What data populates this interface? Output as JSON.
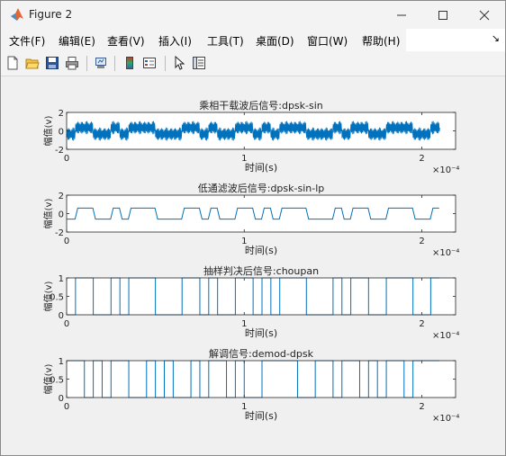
{
  "window": {
    "title": "Figure 2"
  },
  "menu": [
    "文件(F)",
    "编辑(E)",
    "查看(V)",
    "插入(I)",
    "工具(T)",
    "桌面(D)",
    "窗口(W)",
    "帮助(H)"
  ],
  "menu_overflow": "↘",
  "toolbar_icons": [
    "new-figure-icon",
    "open-file-icon",
    "save-icon",
    "print-icon",
    "link-plot-icon",
    "insert-colorbar-icon",
    "insert-legend-icon",
    "edit-plot-arrow-icon",
    "property-inspector-icon"
  ],
  "colors": {
    "line": "#0072bd",
    "axes_bg": "#ffffff",
    "figure_bg": "#f0f0f0"
  },
  "chart_data": [
    {
      "type": "line",
      "title": "乘相干载波后信号:dpsk-sin",
      "xlabel": "时间(s)",
      "ylabel": "幅值(v)",
      "xlim": [
        0,
        0.000219
      ],
      "ylim": [
        -2,
        2
      ],
      "xticks": [
        "0",
        "1",
        "2"
      ],
      "yticks": [
        "2",
        "0",
        "-2"
      ],
      "x_exponent": "×10⁻⁴",
      "bits_per_panel": 42,
      "bit_duration_s": 5e-06,
      "bits": [
        0,
        1,
        1,
        0,
        0,
        1,
        0,
        1,
        1,
        1,
        0,
        0,
        0,
        1,
        1,
        0,
        1,
        0,
        0,
        1,
        1,
        0,
        1,
        0,
        1,
        1,
        1,
        0,
        0,
        0,
        1,
        0,
        1,
        1,
        0,
        0,
        1,
        1,
        1,
        0,
        0,
        1
      ],
      "note": "modulated carrier, amplitude ~±1.2"
    },
    {
      "type": "line",
      "title": "低通滤波后信号:dpsk-sin-lp",
      "xlabel": "时间(s)",
      "ylabel": "幅值(v)",
      "xlim": [
        0,
        0.000219
      ],
      "ylim": [
        -2,
        2
      ],
      "xticks": [
        "0",
        "1",
        "2"
      ],
      "yticks": [
        "2",
        "0",
        "-2"
      ],
      "x_exponent": "×10⁻⁴",
      "bits": [
        0,
        1,
        1,
        0,
        0,
        1,
        0,
        1,
        1,
        1,
        0,
        0,
        0,
        1,
        1,
        0,
        1,
        0,
        0,
        1,
        1,
        0,
        1,
        0,
        1,
        1,
        1,
        0,
        0,
        0,
        1,
        0,
        1,
        1,
        0,
        0,
        1,
        1,
        1,
        0,
        0,
        1
      ],
      "high": 0.6,
      "low": -0.6
    },
    {
      "type": "line",
      "title": "抽样判决后信号:choupan",
      "xlabel": "时间(s)",
      "ylabel": "幅值(v)",
      "xlim": [
        0,
        0.000219
      ],
      "ylim": [
        0,
        1
      ],
      "xticks": [
        "0",
        "1",
        "2"
      ],
      "yticks": [
        "1",
        "0.5",
        "0"
      ],
      "x_exponent": "×10⁻⁴",
      "bits": [
        0,
        1,
        1,
        0,
        0,
        1,
        0,
        1,
        1,
        1,
        0,
        0,
        0,
        1,
        1,
        0,
        1,
        0,
        0,
        1,
        1,
        0,
        1,
        0,
        1,
        1,
        1,
        0,
        0,
        0,
        1,
        0,
        1,
        1,
        0,
        0,
        1,
        1,
        1,
        0,
        0,
        1
      ]
    },
    {
      "type": "line",
      "title": "解调信号:demod-dpsk",
      "xlabel": "时间(s)",
      "ylabel": "幅值(v)",
      "xlim": [
        0,
        0.000219
      ],
      "ylim": [
        0,
        1
      ],
      "xticks": [
        "0",
        "1",
        "2"
      ],
      "yticks": [
        "1",
        "0.5",
        "0"
      ],
      "x_exponent": "×10⁻⁴",
      "bits": [
        1,
        1,
        0,
        1,
        0,
        1,
        1,
        0,
        0,
        1,
        0,
        1,
        0,
        0,
        1,
        0,
        1,
        1,
        0,
        1,
        0,
        0,
        1,
        1,
        1,
        1,
        0,
        0,
        1,
        1,
        0,
        1,
        1,
        0,
        1,
        0,
        1,
        1,
        0,
        1,
        1,
        1
      ]
    }
  ]
}
